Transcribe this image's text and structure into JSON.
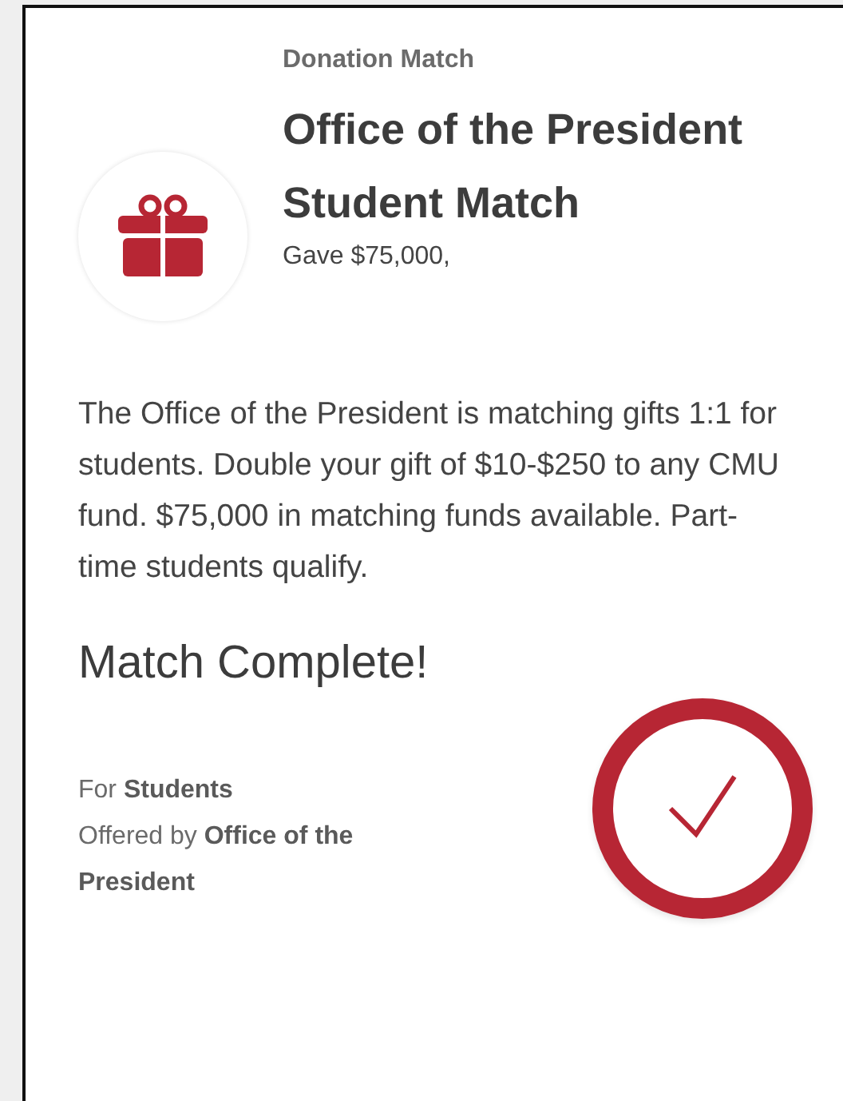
{
  "header": {
    "category": "Donation Match",
    "title": "Office of the President Student Match",
    "progress_text": "Gave $75,000,"
  },
  "description": "The Office of the President is matching gifts 1:1 for students. Double your gift of $10-$250 to any CMU fund. $75,000 in matching funds available. Part-time students qualify.",
  "status": {
    "heading": "Match Complete!",
    "complete": true
  },
  "details": [
    "For **Students**",
    "Offered by **Office of the President**"
  ]
}
